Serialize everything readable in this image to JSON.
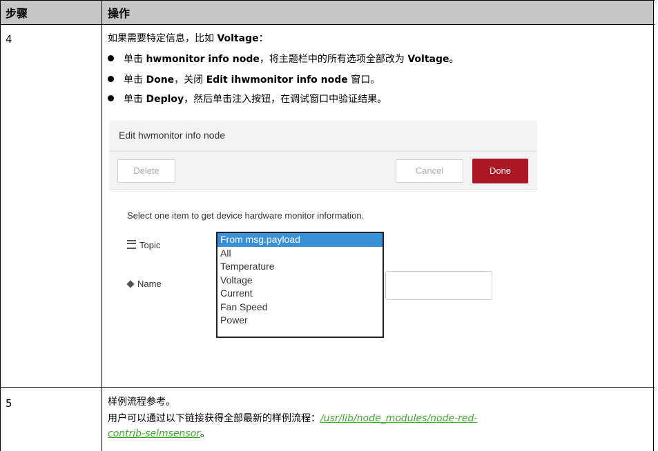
{
  "table": {
    "headers": {
      "step": "步骤",
      "operation": "操作"
    },
    "rows": [
      {
        "step": "4",
        "intro_text": "如果需要特定信息，比如 ",
        "intro_bold": "Voltage",
        "intro_end": "：",
        "bullets": [
          {
            "pre": "单击 ",
            "b1": "hwmonitor info node",
            "mid": "，将主题栏中的所有选项全部改为 ",
            "b2": "Voltage",
            "post": "。"
          },
          {
            "pre": "单击 ",
            "b1": "Done",
            "mid": "，关闭 ",
            "b2": "Edit ihwmonitor info node",
            "post": " 窗口。"
          },
          {
            "pre": "单击 ",
            "b1": "Deploy",
            "mid": "，然后单击注入按钮，在调试窗口中验证结果。",
            "b2": "",
            "post": ""
          }
        ]
      },
      {
        "step": "5",
        "line1": "样例流程参考。",
        "line2_pre": "用户可以通过以下链接获得全部最新的样例流程：",
        "link_part1": "/usr/lib/node_modules/node-red-",
        "link_part2": "contrib-selmsensor",
        "line2_post": "。"
      }
    ]
  },
  "dialog": {
    "title": "Edit hwmonitor info node",
    "delete_label": "Delete",
    "cancel_label": "Cancel",
    "done_label": "Done",
    "description": "Select one item to get device hardware monitor information.",
    "topic_label": "Topic",
    "name_label": "Name",
    "topic_icon": "list-icon",
    "name_icon": "tag-icon",
    "options": [
      "From msg.payload",
      "All",
      "Temperature",
      "Voltage",
      "Current",
      "Fan Speed",
      "Power"
    ],
    "selected_option": "From msg.payload",
    "done_color": "#ad1625",
    "selection_color": "#3a8fd9"
  }
}
